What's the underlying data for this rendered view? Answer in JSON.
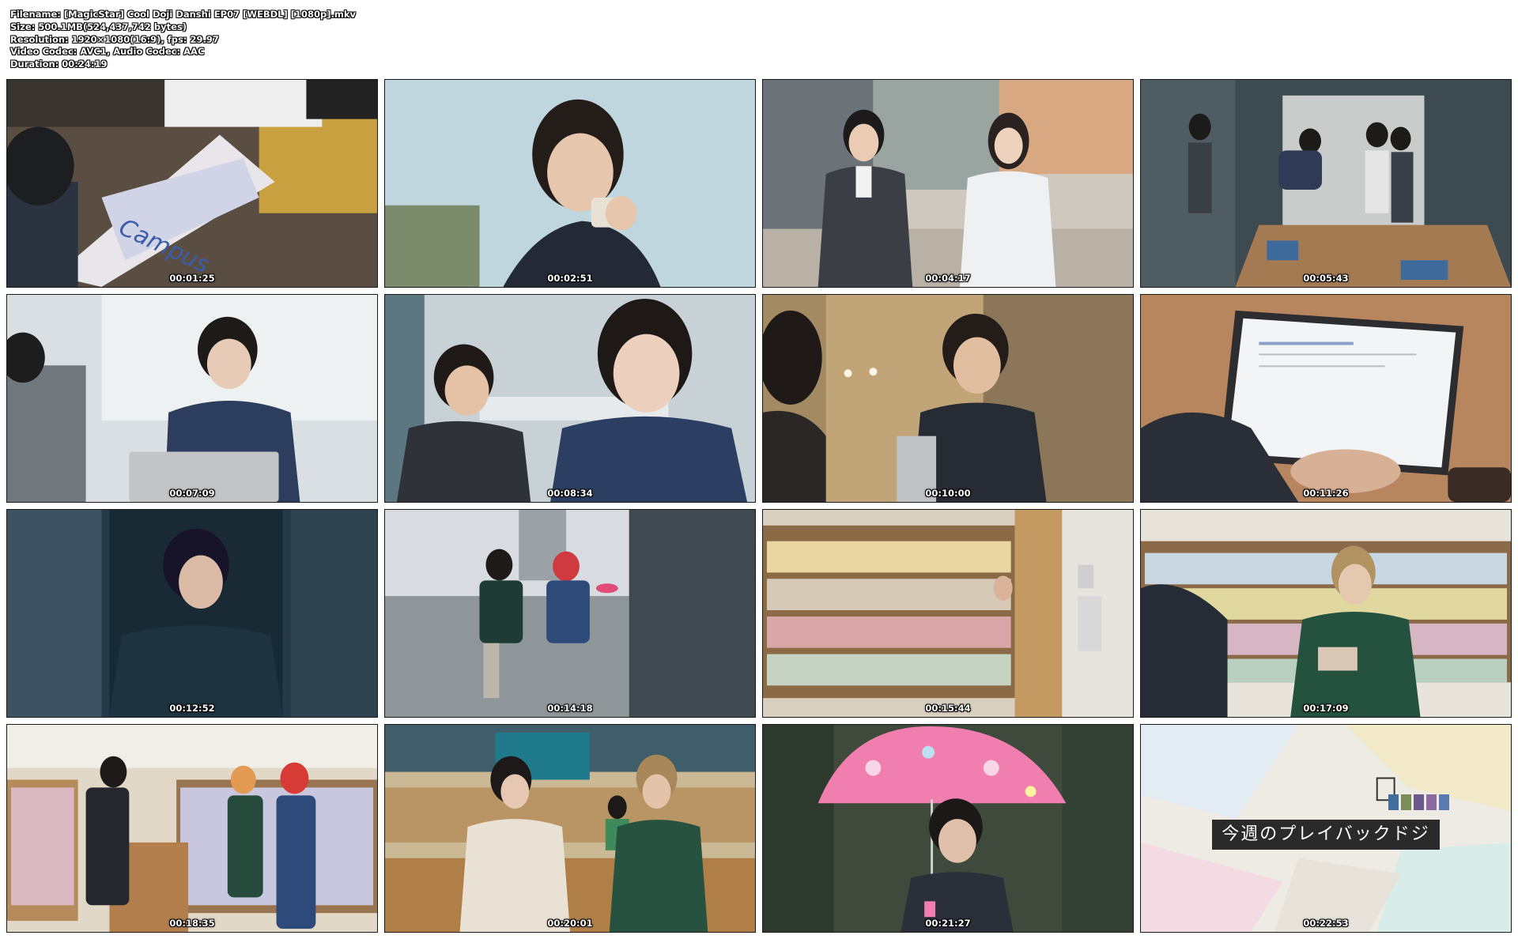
{
  "info": {
    "filename": "Filename: [MagicStar] Cool Doji Danshi EP07 [WEBDL] [1080p].mkv",
    "size": "Size: 500.1MB(524,437,742 bytes)",
    "resolution": "Resolution: 1920×1080(16:9), fps: 29.97",
    "codec": "Video Codec: AVC1, Audio Codec: AAC",
    "duration": "Duration: 00:24:19"
  },
  "thumbnails": [
    {
      "time": "00:01:25",
      "scene": "notebook-handoff"
    },
    {
      "time": "00:02:51",
      "scene": "drinking-coffee"
    },
    {
      "time": "00:04:17",
      "scene": "street-walk"
    },
    {
      "time": "00:05:43",
      "scene": "meeting-room-bow"
    },
    {
      "time": "00:07:09",
      "scene": "laptop-desk"
    },
    {
      "time": "00:08:34",
      "scene": "two-coworkers"
    },
    {
      "time": "00:10:00",
      "scene": "office-conversation"
    },
    {
      "time": "00:11:26",
      "scene": "typing-laptop"
    },
    {
      "time": "00:12:52",
      "scene": "building-entrance"
    },
    {
      "time": "00:14:18",
      "scene": "rainy-plaza"
    },
    {
      "time": "00:15:44",
      "scene": "bookstore-shelves"
    },
    {
      "time": "00:17:09",
      "scene": "bookstore-phone"
    },
    {
      "time": "00:18:35",
      "scene": "bookstore-aisle"
    },
    {
      "time": "00:20:01",
      "scene": "bookstore-counter"
    },
    {
      "time": "00:21:27",
      "scene": "pink-umbrella"
    },
    {
      "time": "00:22:53",
      "scene": "playback-title"
    }
  ],
  "overlay": {
    "notebook_brand": "Campus",
    "playback_caption": "今週のプレイバックドジ"
  },
  "colors": {
    "timestamp": "#ffffff",
    "umbrella": "#f07fb0",
    "caption_bg": "#2a2a2a",
    "swatches": [
      "#3f6f9a",
      "#7a8c5a",
      "#6a5a8a",
      "#8a6aa0",
      "#5a7ab0"
    ]
  }
}
